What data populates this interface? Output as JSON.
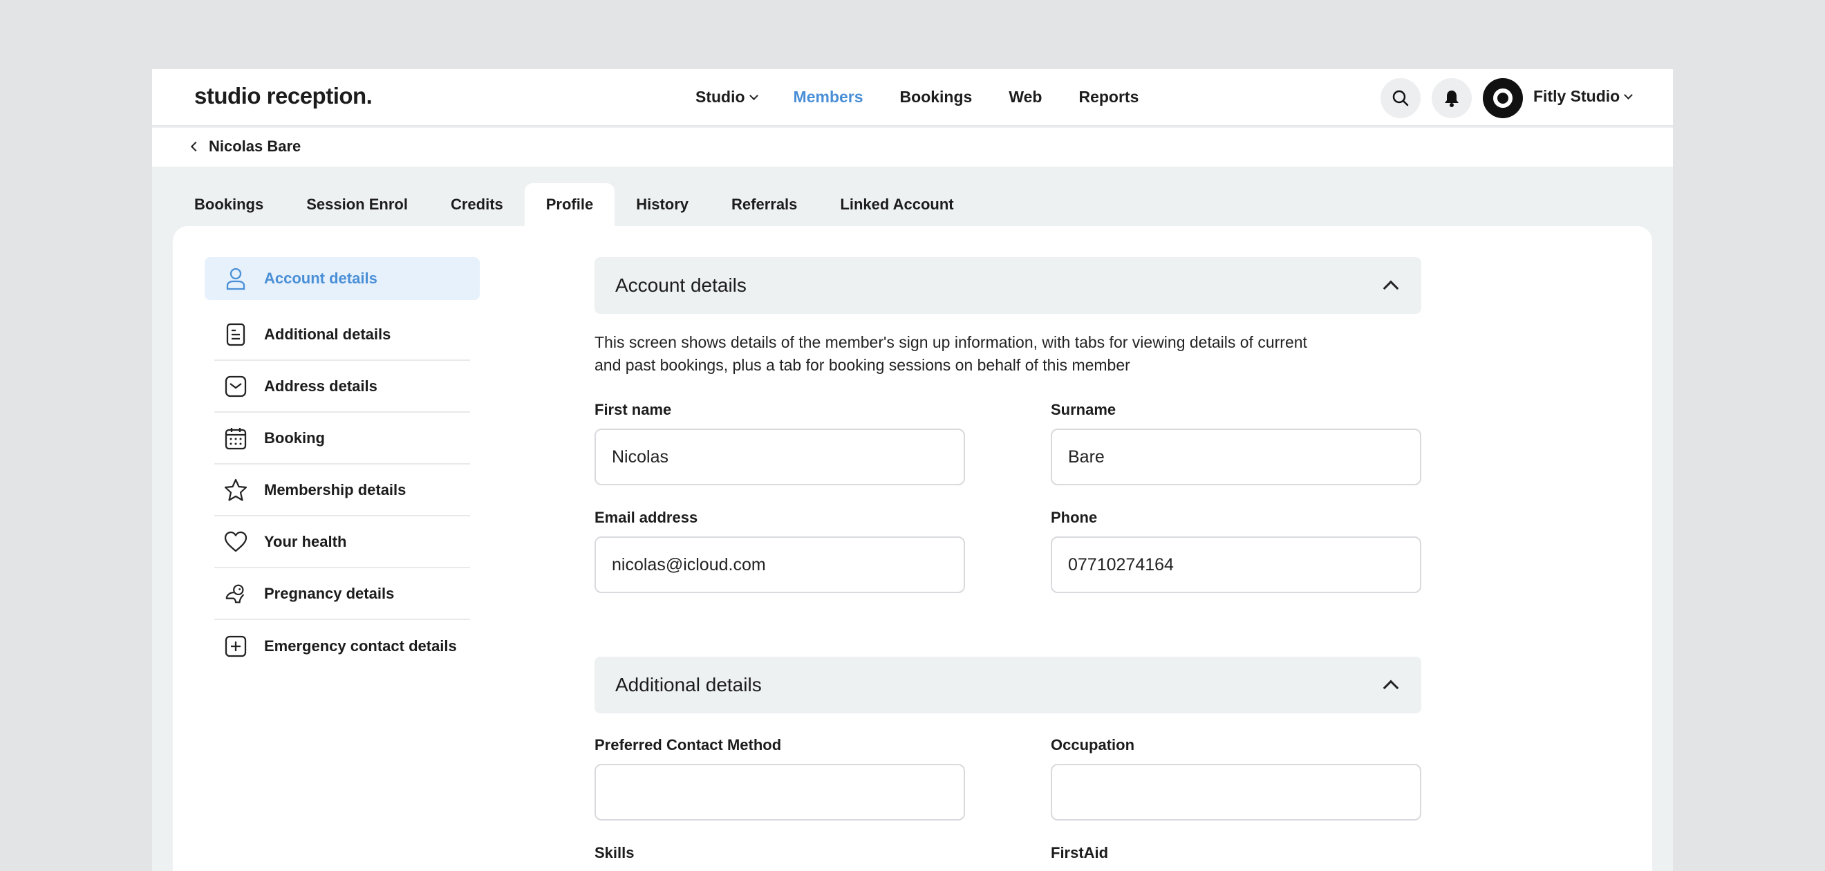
{
  "header": {
    "logo": "studio reception.",
    "nav": [
      {
        "label": "Studio"
      },
      {
        "label": "Members"
      },
      {
        "label": "Bookings"
      },
      {
        "label": "Web"
      },
      {
        "label": "Reports"
      }
    ],
    "account_label": "Fitly Studio"
  },
  "breadcrumb": {
    "back_label": "Nicolas Bare"
  },
  "tabs": [
    {
      "label": "Bookings"
    },
    {
      "label": "Session Enrol"
    },
    {
      "label": "Credits"
    },
    {
      "label": "Profile"
    },
    {
      "label": "History"
    },
    {
      "label": "Referrals"
    },
    {
      "label": "Linked Account"
    }
  ],
  "sidebar": {
    "items": [
      {
        "label": "Account details",
        "icon": "user-icon"
      },
      {
        "label": "Additional details",
        "icon": "document-icon"
      },
      {
        "label": "Address details",
        "icon": "mail-icon"
      },
      {
        "label": "Booking",
        "icon": "calendar-icon"
      },
      {
        "label": "Membership details",
        "icon": "star-icon"
      },
      {
        "label": "Your health",
        "icon": "heart-icon"
      },
      {
        "label": "Pregnancy details",
        "icon": "baby-icon"
      },
      {
        "label": "Emergency contact details",
        "icon": "plus-square-icon"
      }
    ]
  },
  "account": {
    "title": "Account details",
    "description": "This screen shows details of the member's sign up information, with tabs for viewing details of current and past bookings, plus a tab for booking sessions on behalf of this member",
    "first_name_label": "First name",
    "first_name_value": "Nicolas",
    "surname_label": "Surname",
    "surname_value": "Bare",
    "email_label": "Email address",
    "email_value": "nicolas@icloud.com",
    "phone_label": "Phone",
    "phone_value": "07710274164"
  },
  "additional": {
    "title": "Additional details",
    "contact_method_label": "Preferred Contact Method",
    "contact_method_value": "",
    "occupation_label": "Occupation",
    "occupation_value": "",
    "skills_label": "Skills",
    "firstaid_label": "FirstAid"
  },
  "colors": {
    "accent": "#4a8fd6",
    "active_bg": "#e6f1fc",
    "section_bg": "#eef1f2"
  }
}
